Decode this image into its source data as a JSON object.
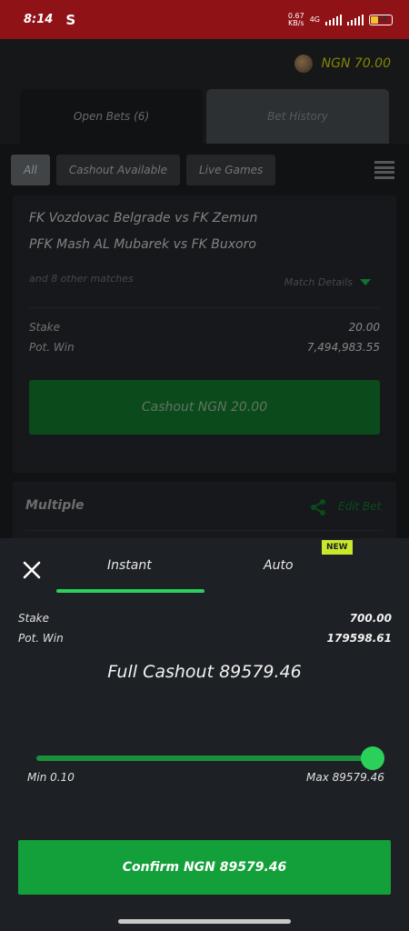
{
  "status_bar": {
    "time": "8:14",
    "app_icon": "S",
    "net_speed_top": "0.67",
    "net_speed_bottom": "KB/s",
    "network": "4G",
    "battery_level": "14"
  },
  "header": {
    "balance": "NGN 70.00"
  },
  "tabs": [
    {
      "label": "Open Bets (6)"
    },
    {
      "label": "Bet History"
    }
  ],
  "filters": [
    {
      "label": "All"
    },
    {
      "label": "Cashout Available"
    },
    {
      "label": "Live Games"
    }
  ],
  "bet_card": {
    "matches": [
      "FK Vozdovac Belgrade vs FK Zemun",
      "PFK Mash AL Mubarek vs FK Buxoro"
    ],
    "other_matches": "and 8 other matches",
    "match_details": "Match Details",
    "stake_label": "Stake",
    "stake_value": "20.00",
    "pot_win_label": "Pot. Win",
    "pot_win_value": "7,494,983.55",
    "cashout_button": "Cashout NGN 20.00"
  },
  "bet_card_2": {
    "title": "Multiple",
    "edit_bet": "Edit Bet"
  },
  "sheet": {
    "tab_instant": "Instant",
    "tab_auto": "Auto",
    "new_badge": "NEW",
    "stake_label": "Stake",
    "stake_value": "700.00",
    "pot_win_label": "Pot. Win",
    "pot_win_value": "179598.61",
    "full_cashout": "Full Cashout 89579.46",
    "slider": {
      "min_label": "Min 0.10",
      "max_label": "Max 89579.46",
      "level": 1.0
    },
    "confirm_button": "Confirm NGN 89579.46"
  },
  "colors": {
    "status_bar": "#8f1216",
    "accent_green": "#2bd05a",
    "button_green": "#13a03a",
    "balance_yellow": "#d6d600",
    "new_badge": "#c8e82c"
  }
}
